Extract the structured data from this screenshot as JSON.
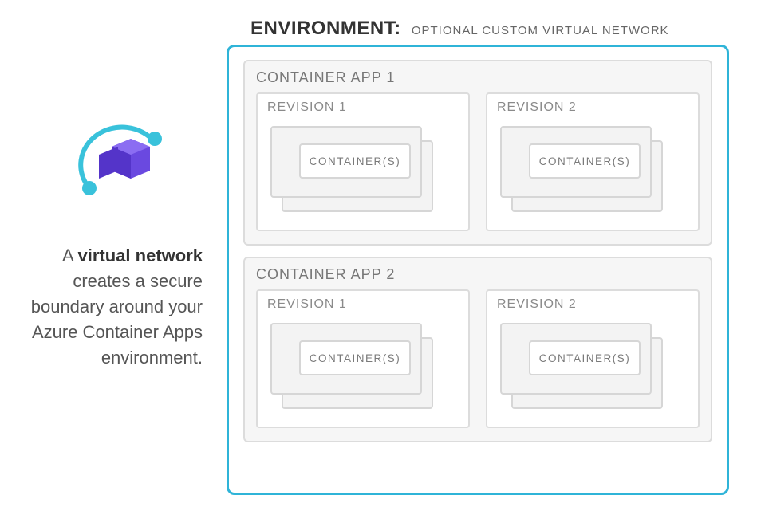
{
  "left": {
    "desc_prefix": "A ",
    "desc_bold": "virtual network",
    "desc_rest": " creates a secure boundary around your Azure Container Apps environment."
  },
  "env": {
    "title_label": "ENVIRONMENT:",
    "subtitle": "OPTIONAL CUSTOM VIRTUAL NETWORK"
  },
  "apps": [
    {
      "title": "CONTAINER APP 1",
      "revisions": [
        {
          "title": "REVISION 1",
          "container_label": "CONTAINER(S)"
        },
        {
          "title": "REVISION 2",
          "container_label": "CONTAINER(S)"
        }
      ]
    },
    {
      "title": "CONTAINER APP 2",
      "revisions": [
        {
          "title": "REVISION 1",
          "container_label": "CONTAINER(S)"
        },
        {
          "title": "REVISION 2",
          "container_label": "CONTAINER(S)"
        }
      ]
    }
  ],
  "colors": {
    "accent": "#2fb4d8",
    "icon_purple": "#5d3fd3"
  }
}
